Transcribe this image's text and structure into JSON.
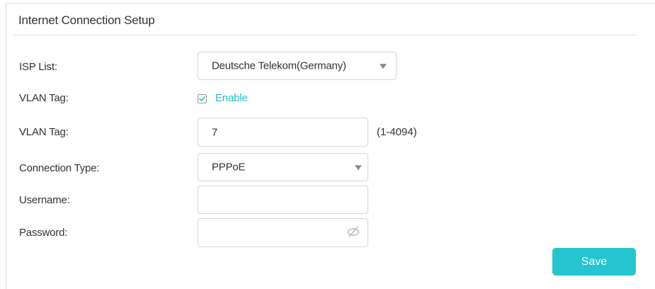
{
  "section": {
    "title": "Internet Connection Setup"
  },
  "form": {
    "isp_list": {
      "label": "ISP List:",
      "value": "Deutsche Telekom(Germany)"
    },
    "vlan_enable": {
      "label": "VLAN Tag:",
      "checkbox_label": "Enable",
      "checked": true
    },
    "vlan_tag": {
      "label": "VLAN Tag:",
      "value": "7",
      "range_hint": "(1-4094)"
    },
    "connection_type": {
      "label": "Connection Type:",
      "value": "PPPoE"
    },
    "username": {
      "label": "Username:",
      "value": ""
    },
    "password": {
      "label": "Password:",
      "value": ""
    }
  },
  "actions": {
    "save_label": "Save"
  },
  "colors": {
    "accent": "#23c6d0",
    "enable_text": "#1ec2c9"
  },
  "icons": {
    "dropdown": "caret-down-icon",
    "checkbox": "checkmark-icon",
    "password_toggle": "eye-hidden-icon"
  }
}
